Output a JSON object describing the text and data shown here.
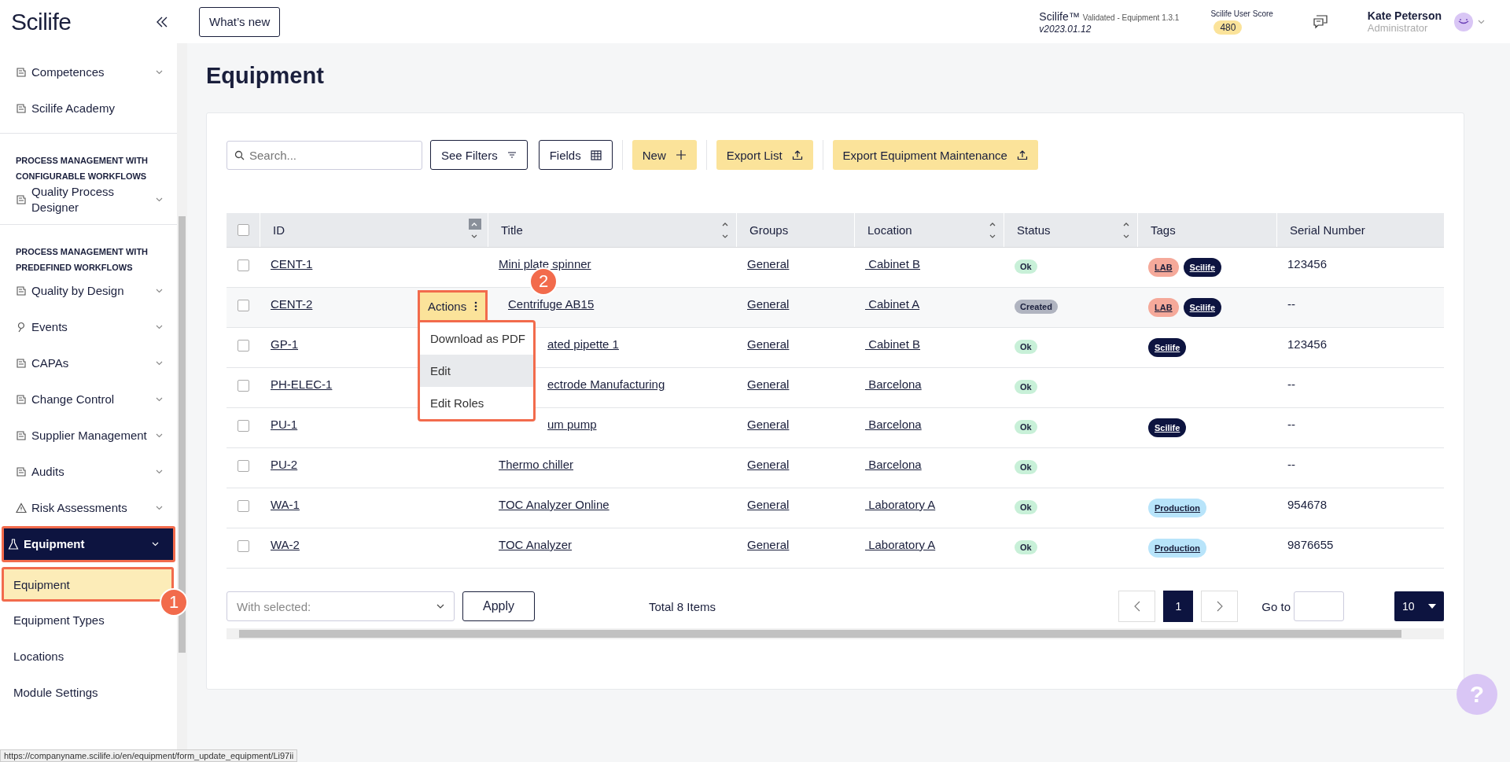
{
  "sidebar": {
    "logo": "Scilife",
    "items": [
      {
        "kind": "item",
        "label": "Competences",
        "expandable": true,
        "selected": false
      },
      {
        "kind": "item",
        "label": "Scilife Academy",
        "expandable": false,
        "selected": false
      },
      {
        "kind": "section",
        "label": "PROCESS MANAGEMENT WITH CONFIGURABLE WORKFLOWS"
      },
      {
        "kind": "item",
        "label": "Quality Process Designer",
        "expandable": true,
        "selected": false
      },
      {
        "kind": "section",
        "label": "PROCESS MANAGEMENT WITH PREDEFINED WORKFLOWS"
      },
      {
        "kind": "item",
        "label": "Quality by Design",
        "expandable": true,
        "selected": false
      },
      {
        "kind": "item",
        "label": "Events",
        "expandable": true,
        "selected": false
      },
      {
        "kind": "item",
        "label": "CAPAs",
        "expandable": true,
        "selected": false
      },
      {
        "kind": "item",
        "label": "Change Control",
        "expandable": true,
        "selected": false
      },
      {
        "kind": "item",
        "label": "Supplier Management",
        "expandable": true,
        "selected": false
      },
      {
        "kind": "item",
        "label": "Audits",
        "expandable": true,
        "selected": false
      },
      {
        "kind": "item",
        "label": "Risk Assessments",
        "expandable": true,
        "selected": false
      },
      {
        "kind": "item",
        "label": "Equipment",
        "expandable": true,
        "selected": true
      },
      {
        "kind": "subitem",
        "label": "Equipment",
        "selected": true
      },
      {
        "kind": "subitem",
        "label": "Equipment Types",
        "selected": false
      },
      {
        "kind": "subitem",
        "label": "Locations",
        "selected": false
      },
      {
        "kind": "subitem",
        "label": "Module Settings",
        "selected": false
      }
    ]
  },
  "status_url": "https://companyname.scilife.io/en/equipment/form_update_equipment/Li97ii",
  "header": {
    "whats_new": "What’s new",
    "product": "Scilife™",
    "validated": "Validated - Equipment 1.3.1",
    "version": "v2023.01.12",
    "score_label": "Scilife User Score",
    "score": "480",
    "user_name": "Kate Peterson",
    "user_role": "Administrator"
  },
  "page_title": "Equipment",
  "toolbar": {
    "search_placeholder": "Search...",
    "filters": "See Filters",
    "fields": "Fields",
    "new": "New",
    "export_list": "Export List",
    "export_maintenance": "Export Equipment Maintenance"
  },
  "table": {
    "select_all_checked": false,
    "columns": [
      {
        "label": "ID",
        "sortable": true,
        "sorted": true
      },
      {
        "label": "Title",
        "sortable": true,
        "sorted": false
      },
      {
        "label": "Groups",
        "sortable": false,
        "sorted": false
      },
      {
        "label": "Location",
        "sortable": true,
        "sorted": false
      },
      {
        "label": "Status",
        "sortable": true,
        "sorted": false
      },
      {
        "label": "Tags",
        "sortable": false,
        "sorted": false
      },
      {
        "label": "Serial Number",
        "sortable": false,
        "sorted": false
      }
    ],
    "rows": [
      {
        "checked": false,
        "actions_open": false,
        "id": "CENT-1",
        "title": "Mini plate spinner",
        "group": "General",
        "location": " Cabinet B",
        "status": {
          "label": "Ok",
          "color": "#c8f0d8"
        },
        "tags": [
          {
            "label": "LAB",
            "color": "#f5a99a"
          },
          {
            "label": "Scilife",
            "color": "#0d1440"
          }
        ],
        "serial": "123456"
      },
      {
        "checked": false,
        "actions_open": true,
        "id": "CENT-2",
        "title": "Centrifuge AB15",
        "group": "General",
        "location": " Cabinet A",
        "status": {
          "label": "Created",
          "color": "#b0b4c0"
        },
        "tags": [
          {
            "label": "LAB",
            "color": "#f5a99a"
          },
          {
            "label": "Scilife",
            "color": "#0d1440"
          }
        ],
        "serial": "--"
      },
      {
        "checked": false,
        "actions_open": false,
        "id": "GP-1",
        "title": "ated pipette 1",
        "group": "General",
        "location": " Cabinet B",
        "status": {
          "label": "Ok",
          "color": "#c8f0d8"
        },
        "tags": [
          {
            "label": "Scilife",
            "color": "#0d1440"
          }
        ],
        "serial": "123456"
      },
      {
        "checked": false,
        "actions_open": false,
        "id": "PH-ELEC-1",
        "title": "ectrode Manufacturing",
        "group": "General",
        "location": " Barcelona",
        "status": {
          "label": "Ok",
          "color": "#c8f0d8"
        },
        "tags": [],
        "serial": "--"
      },
      {
        "checked": false,
        "actions_open": false,
        "id": "PU-1",
        "title": "um pump",
        "group": "General",
        "location": " Barcelona",
        "status": {
          "label": "Ok",
          "color": "#c8f0d8"
        },
        "tags": [
          {
            "label": "Scilife",
            "color": "#0d1440"
          }
        ],
        "serial": "--"
      },
      {
        "checked": false,
        "actions_open": false,
        "id": "PU-2",
        "title": "Thermo chiller",
        "group": "General",
        "location": " Barcelona",
        "status": {
          "label": "Ok",
          "color": "#c8f0d8"
        },
        "tags": [],
        "serial": "--"
      },
      {
        "checked": false,
        "actions_open": false,
        "id": "WA-1",
        "title": "TOC Analyzer Online",
        "group": "General",
        "location": " Laboratory A",
        "status": {
          "label": "Ok",
          "color": "#c8f0d8"
        },
        "tags": [
          {
            "label": "Production",
            "color": "#b8e4fa"
          }
        ],
        "serial": "954678"
      },
      {
        "checked": false,
        "actions_open": false,
        "id": "WA-2",
        "title": "TOC Analyzer",
        "group": "General",
        "location": " Laboratory A",
        "status": {
          "label": "Ok",
          "color": "#c8f0d8"
        },
        "tags": [
          {
            "label": "Production",
            "color": "#b8e4fa"
          }
        ],
        "serial": "9876655"
      }
    ]
  },
  "actions_menu": {
    "button": "Actions",
    "items": [
      {
        "label": "Download as PDF",
        "hovered": false
      },
      {
        "label": "Edit",
        "hovered": true
      },
      {
        "label": "Edit Roles",
        "hovered": false
      }
    ]
  },
  "callouts": [
    "1",
    "2"
  ],
  "footer": {
    "with_selected_placeholder": "With selected:",
    "apply": "Apply",
    "total": "Total 8 Items",
    "pages": [
      {
        "label": "1",
        "selected": true
      }
    ],
    "goto_label": "Go to",
    "page_size": "10"
  },
  "help": "?"
}
